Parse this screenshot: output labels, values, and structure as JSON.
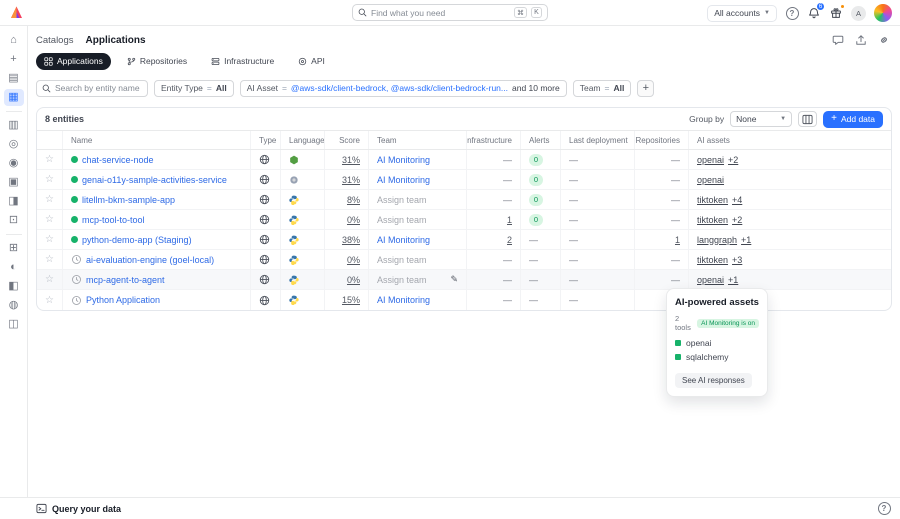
{
  "topbar": {
    "search_placeholder": "Find what you need",
    "key_cmd": "⌘",
    "key_k": "K",
    "accounts_label": "All accounts",
    "inbox_badge": "6",
    "avatar_initial": "A"
  },
  "breadcrumb": {
    "parent": "Catalogs",
    "current": "Applications"
  },
  "tabs": [
    {
      "label": "Applications",
      "active": true
    },
    {
      "label": "Repositories",
      "active": false
    },
    {
      "label": "Infrastructure",
      "active": false
    },
    {
      "label": "API",
      "active": false
    }
  ],
  "filters": {
    "search_placeholder": "Search by entity name",
    "chips": [
      {
        "field": "Entity Type",
        "op": "=",
        "value": "All"
      },
      {
        "field": "AI Asset",
        "op": "=",
        "value": "@aws-sdk/client-bedrock, @aws-sdk/client-bedrock-run...",
        "suffix": "and 10 more"
      },
      {
        "field": "Team",
        "op": "=",
        "value": "All"
      }
    ]
  },
  "table": {
    "count_label": "8 entities",
    "group_by_label": "Group by",
    "group_by_value": "None",
    "add_button_label": "Add data",
    "columns": [
      "Name",
      "Type",
      "Language",
      "Score",
      "Team",
      "Infrastructure",
      "Alerts",
      "Last deployment",
      "Repositories",
      "AI assets"
    ],
    "rows": [
      {
        "status": "healthy",
        "name": "chat-service-node",
        "language": "node",
        "score": "31%",
        "team": "AI Monitoring",
        "team_assigned": true,
        "editing": false,
        "hover": false,
        "infrastructure": "—",
        "alerts": "0",
        "last_deployment": "—",
        "repositories": "—",
        "ai_base": "openai",
        "ai_more": "+2"
      },
      {
        "status": "healthy",
        "name": "genai-o11y-sample-activities-service",
        "language": "unknown",
        "score": "31%",
        "team": "AI Monitoring",
        "team_assigned": true,
        "editing": false,
        "hover": false,
        "infrastructure": "—",
        "alerts": "0",
        "last_deployment": "—",
        "repositories": "—",
        "ai_base": "openai",
        "ai_more": ""
      },
      {
        "status": "healthy",
        "name": "litellm-bkm-sample-app",
        "language": "python",
        "score": "8%",
        "team": "Assign team",
        "team_assigned": false,
        "editing": false,
        "hover": false,
        "infrastructure": "—",
        "alerts": "0",
        "last_deployment": "—",
        "repositories": "—",
        "ai_base": "tiktoken",
        "ai_more": "+4"
      },
      {
        "status": "healthy",
        "name": "mcp-tool-to-tool",
        "language": "python",
        "score": "0%",
        "team": "Assign team",
        "team_assigned": false,
        "editing": false,
        "hover": false,
        "infrastructure": "1",
        "alerts": "0",
        "last_deployment": "—",
        "repositories": "—",
        "ai_base": "tiktoken",
        "ai_more": "+2"
      },
      {
        "status": "healthy",
        "name": "python-demo-app (Staging)",
        "language": "python",
        "score": "38%",
        "team": "AI Monitoring",
        "team_assigned": true,
        "editing": false,
        "hover": false,
        "infrastructure": "2",
        "alerts": "—",
        "last_deployment": "—",
        "repositories": "1",
        "ai_base": "langgraph",
        "ai_more": "+1"
      },
      {
        "status": "pending",
        "name": "ai-evaluation-engine (goel-local)",
        "language": "python",
        "score": "0%",
        "team": "Assign team",
        "team_assigned": false,
        "editing": false,
        "hover": false,
        "infrastructure": "—",
        "alerts": "—",
        "last_deployment": "—",
        "repositories": "—",
        "ai_base": "tiktoken",
        "ai_more": "+3"
      },
      {
        "status": "pending",
        "name": "mcp-agent-to-agent",
        "language": "python",
        "score": "0%",
        "team": "Assign team",
        "team_assigned": false,
        "editing": true,
        "hover": true,
        "infrastructure": "—",
        "alerts": "—",
        "last_deployment": "—",
        "repositories": "—",
        "ai_base": "openai",
        "ai_more": "+1"
      },
      {
        "status": "pending",
        "name": "Python Application",
        "language": "python",
        "score": "15%",
        "team": "AI Monitoring",
        "team_assigned": true,
        "editing": false,
        "hover": false,
        "infrastructure": "—",
        "alerts": "—",
        "last_deployment": "—",
        "repositories": "",
        "ai_base": "",
        "ai_more": ""
      }
    ]
  },
  "tooltip": {
    "title": "AI-powered assets",
    "count": "2 tools",
    "badge": "AI Monitoring is on",
    "items": [
      "openai",
      "sqlalchemy"
    ],
    "button": "See AI responses"
  },
  "footer": {
    "query_label": "Query your data"
  },
  "sidebar": {
    "items": [
      {
        "name": "home",
        "glyph": "⌂"
      },
      {
        "name": "add",
        "glyph": "+"
      },
      {
        "name": "builder",
        "glyph": "▤"
      },
      {
        "name": "catalog",
        "glyph": "▦",
        "active": true
      },
      {
        "divider": true
      },
      {
        "name": "entities",
        "glyph": "▥"
      },
      {
        "name": "users",
        "glyph": "◎"
      },
      {
        "name": "self-service",
        "glyph": "◉"
      },
      {
        "name": "automations",
        "glyph": "▣"
      },
      {
        "name": "scorecards",
        "glyph": "◨"
      },
      {
        "name": "bookmarks",
        "glyph": "⊡"
      },
      {
        "divider": true
      },
      {
        "name": "docs",
        "glyph": "⊞"
      },
      {
        "name": "audit-log",
        "glyph": "◐"
      },
      {
        "name": "insights",
        "glyph": "◧"
      },
      {
        "name": "experiments",
        "glyph": "◍"
      },
      {
        "name": "integrations",
        "glyph": "◫"
      }
    ]
  },
  "colors": {
    "accent_blue": "#2970ff",
    "link_blue": "#2e6ae6",
    "success_green": "#17b26a",
    "badge_green_bg": "#d7f5e2",
    "badge_green_text": "#079455",
    "tab_active_bg": "#181d27",
    "border": "#e9eaeb"
  }
}
